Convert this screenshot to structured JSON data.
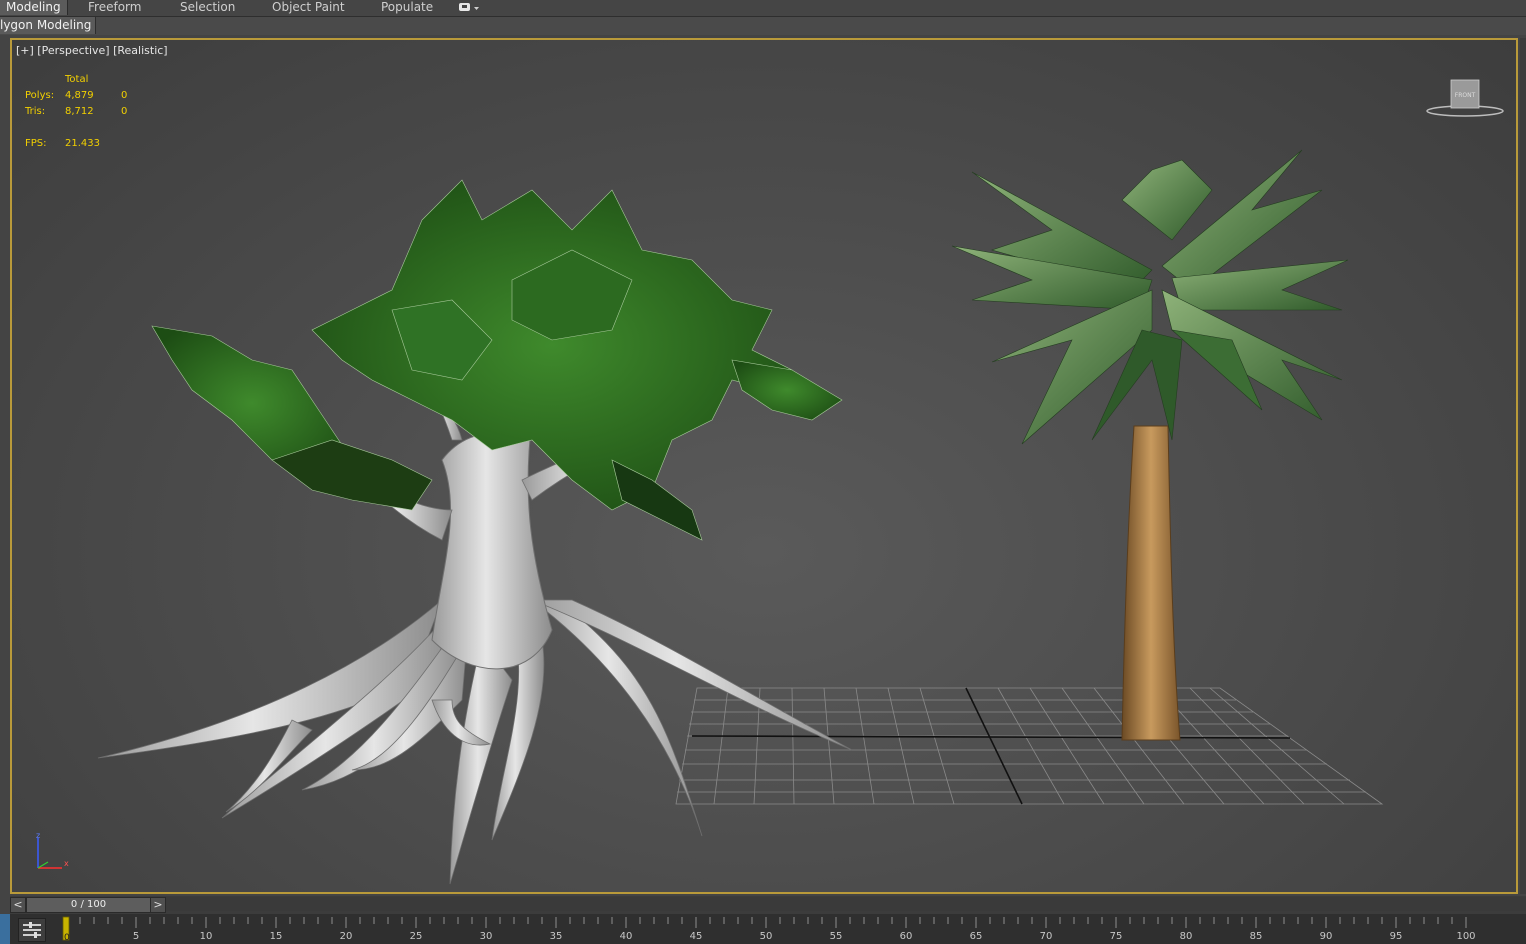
{
  "ribbon": {
    "tabs": [
      {
        "label": "Modeling",
        "active": true
      },
      {
        "label": "Freeform",
        "active": false
      },
      {
        "label": "Selection",
        "active": false
      },
      {
        "label": "Object Paint",
        "active": false
      },
      {
        "label": "Populate",
        "active": false
      }
    ],
    "subtab": "lygon Modeling"
  },
  "viewport": {
    "label": "[+] [Perspective] [Realistic]",
    "stats": {
      "header": "Total",
      "polys_label": "Polys:",
      "polys_total": "4,879",
      "polys_selected": "0",
      "tris_label": "Tris:",
      "tris_total": "8,712",
      "tris_selected": "0",
      "fps_label": "FPS:",
      "fps_value": "21.433"
    },
    "viewcube_face": "FRONT",
    "axis_labels": {
      "z": "z",
      "x": "x"
    },
    "border_color": "#b99a3a"
  },
  "timeslider": {
    "prev": "<",
    "next": ">",
    "position": "0 / 100"
  },
  "trackbar": {
    "current_frame": "0",
    "ticks": [
      "5",
      "10",
      "15",
      "20",
      "25",
      "30",
      "35",
      "40",
      "45",
      "50",
      "55",
      "60",
      "65",
      "70",
      "75",
      "80",
      "85",
      "90",
      "95",
      "100"
    ]
  }
}
